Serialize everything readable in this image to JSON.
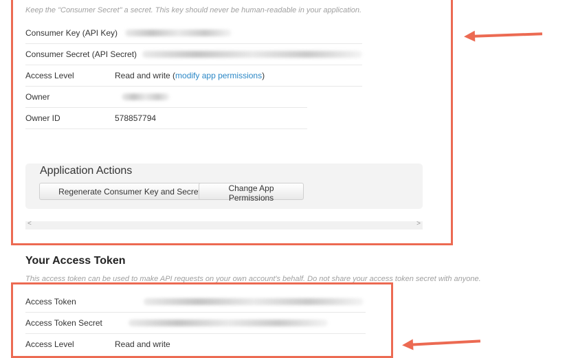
{
  "consumer": {
    "hint": "Keep the \"Consumer Secret\" a secret. This key should never be human-readable in your application.",
    "rows": [
      {
        "label": "Consumer Key (API Key)",
        "value": ""
      },
      {
        "label": "Consumer Secret (API Secret)",
        "value": ""
      },
      {
        "label": "Access Level",
        "value": "Read and write ",
        "link": "modify app permissions"
      },
      {
        "label": "Owner",
        "value": ""
      },
      {
        "label": "Owner ID",
        "value": "578857794"
      }
    ]
  },
  "actions": {
    "title": "Application Actions",
    "regenerate_label": "Regenerate Consumer Key and Secret",
    "change_label": "Change App Permissions"
  },
  "scrollbar": {
    "left": "<",
    "right": ">"
  },
  "access_token": {
    "title": "Your Access Token",
    "hint": "This access token can be used to make API requests on your own account's behalf. Do not share your access token secret with anyone.",
    "rows": [
      {
        "label": "Access Token",
        "value": ""
      },
      {
        "label": "Access Token Secret",
        "value": ""
      },
      {
        "label": "Access Level",
        "value": "Read and write"
      }
    ]
  },
  "colors": {
    "highlight": "#ec6a52",
    "link": "#2a87c6",
    "actions_bg": "#f3f3f3"
  },
  "icons": [
    "arrow-left-icon",
    "arrow-left-icon"
  ]
}
